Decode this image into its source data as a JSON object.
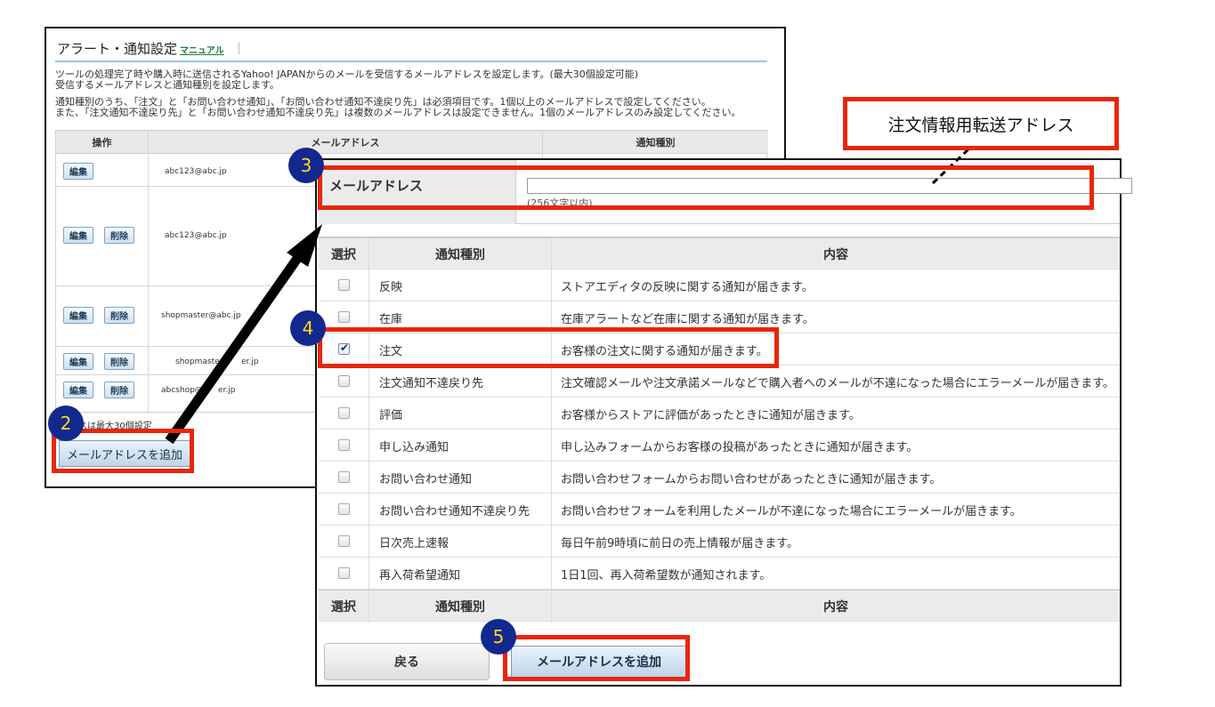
{
  "back_panel": {
    "title": "アラート・通知設定",
    "manual_link": "マニュアル",
    "desc_line1": "ツールの処理完了時や購入時に送信されるYahoo! JAPANからのメールを受信するメールアドレスを設定します。(最大30個設定可能)",
    "desc_line2": "受信するメールアドレスと通知種別を設定します。",
    "desc_line3": "通知種別のうち、「注文」と「お問い合わせ通知」、「お問い合わせ通知不達戻り先」は必須項目です。1個以上のメールアドレスで設定してください。",
    "desc_line4": "また、「注文通知不達戻り先」と「お問い合わせ通知不達戻り先」は複数のメールアドレスは設定できません。1個のメールアドレスのみ設定してください。",
    "table_headers": {
      "op": "操作",
      "email": "メールアドレス",
      "type": "通知種別"
    },
    "edit_label": "編集",
    "delete_label": "削除",
    "rows": [
      {
        "email": "abc123@abc.jp"
      },
      {
        "email": "abc123@abc.jp"
      },
      {
        "email": "shopmaster@abc.jp"
      },
      {
        "email": "shopmaster@",
        "email_tail": "er.jp"
      },
      {
        "email": "abcshop@",
        "email_tail": "er.jp"
      }
    ],
    "footnote": "レスは最大30個設定",
    "add_button": "メールアドレスを追加"
  },
  "front_panel": {
    "email_label": "メールアドレス",
    "email_value": "",
    "email_hint": "(256文字以内)",
    "header": {
      "select": "選択",
      "type": "通知種別",
      "content": "内容"
    },
    "rows": [
      {
        "type": "反映",
        "desc": "ストアエディタの反映に関する通知が届きます。",
        "checked": false
      },
      {
        "type": "在庫",
        "desc": "在庫アラートなど在庫に関する通知が届きます。",
        "checked": false
      },
      {
        "type": "注文",
        "desc": "お客様の注文に関する通知が届きます。",
        "checked": true
      },
      {
        "type": "注文通知不達戻り先",
        "desc": "注文確認メールや注文承諾メールなどで購入者へのメールが不達になった場合にエラーメールが届きます。",
        "checked": false
      },
      {
        "type": "評価",
        "desc": "お客様からストアに評価があったときに通知が届きます。",
        "checked": false
      },
      {
        "type": "申し込み通知",
        "desc": "申し込みフォームからお客様の投稿があったときに通知が届きます。",
        "checked": false
      },
      {
        "type": "お問い合わせ通知",
        "desc": "お問い合わせフォームからお問い合わせがあったときに通知が届きます。",
        "checked": false
      },
      {
        "type": "お問い合わせ通知不達戻り先",
        "desc": "お問い合わせフォームを利用したメールが不達になった場合にエラーメールが届きます。",
        "checked": false
      },
      {
        "type": "日次売上速報",
        "desc": "毎日午前9時頃に前日の売上情報が届きます。",
        "checked": false
      },
      {
        "type": "再入荷希望通知",
        "desc": "1日1回、再入荷希望数が通知されます。",
        "checked": false
      }
    ],
    "back_button": "戻る",
    "add_button": "メールアドレスを追加"
  },
  "annotations": {
    "callout": "注文情報用転送アドレス",
    "step2": "2",
    "step3": "3",
    "step4": "4",
    "step5": "5",
    "accent_red": "#e8260b",
    "badge_blue": "#12288f",
    "badge_yellow": "#ffd91c"
  }
}
